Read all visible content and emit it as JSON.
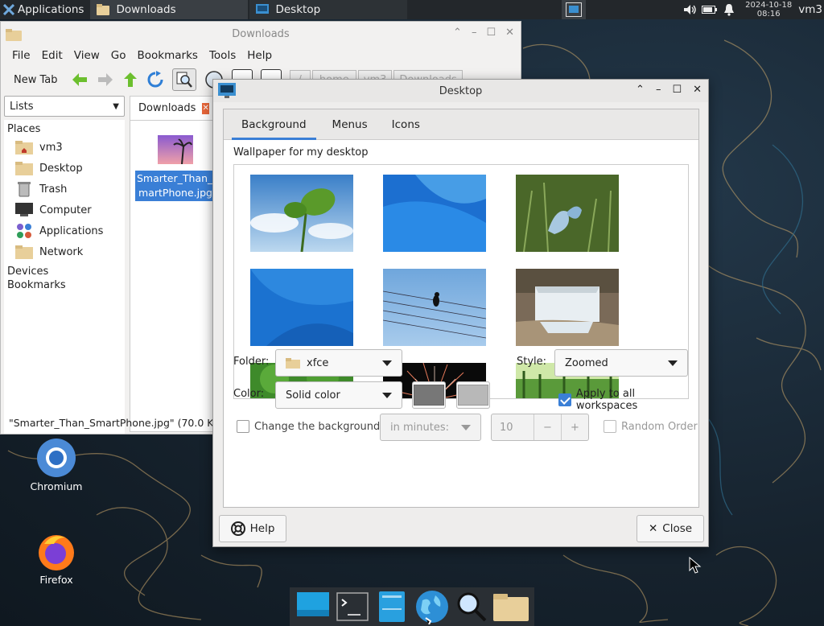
{
  "top_panel": {
    "apps_label": "Applications",
    "tasks": [
      {
        "label": "Downloads"
      },
      {
        "label": "Desktop"
      }
    ],
    "clock_date": "2024-10-18",
    "clock_time": "08:16",
    "user": "vm3"
  },
  "file_manager": {
    "title": "Downloads",
    "menu": [
      "File",
      "Edit",
      "View",
      "Go",
      "Bookmarks",
      "Tools",
      "Help"
    ],
    "toolbar": {
      "new_tab": "New Tab",
      "path": [
        "/",
        "home",
        "vm3",
        "Downloads"
      ]
    },
    "side_mode": "Lists",
    "places_header": "Places",
    "places": [
      {
        "label": "vm3",
        "icon": "home-folder-icon"
      },
      {
        "label": "Desktop",
        "icon": "folder-icon"
      },
      {
        "label": "Trash",
        "icon": "trash-icon"
      },
      {
        "label": "Computer",
        "icon": "computer-icon"
      },
      {
        "label": "Applications",
        "icon": "applications-icon"
      },
      {
        "label": "Network",
        "icon": "folder-icon"
      }
    ],
    "devices_header": "Devices",
    "bookmarks_header": "Bookmarks",
    "tab_label": "Downloads",
    "file_name_line1": "Smarter_Than_S",
    "file_name_line2": "martPhone.jpg",
    "status": "\"Smarter_Than_SmartPhone.jpg\" (70.0 KiB)"
  },
  "desktop_icons": [
    {
      "label": "Chromium"
    },
    {
      "label": "Firefox"
    }
  ],
  "dialog": {
    "title": "Desktop",
    "tabs": [
      "Background",
      "Menus",
      "Icons"
    ],
    "wallpaper_label": "Wallpaper for my desktop",
    "folder_label": "Folder:",
    "folder_value": "xfce",
    "style_label": "Style:",
    "style_value": "Zoomed",
    "color_label": "Color:",
    "color_value": "Solid color",
    "apply_all_label": "Apply to all workspaces",
    "change_bg_label": "Change the background",
    "interval_value": "in minutes:",
    "interval_number": "10",
    "random_order_label": "Random Order",
    "help_label": "Help",
    "close_label": "Close",
    "color1": "#777777",
    "color2": "#b8b8b8"
  }
}
